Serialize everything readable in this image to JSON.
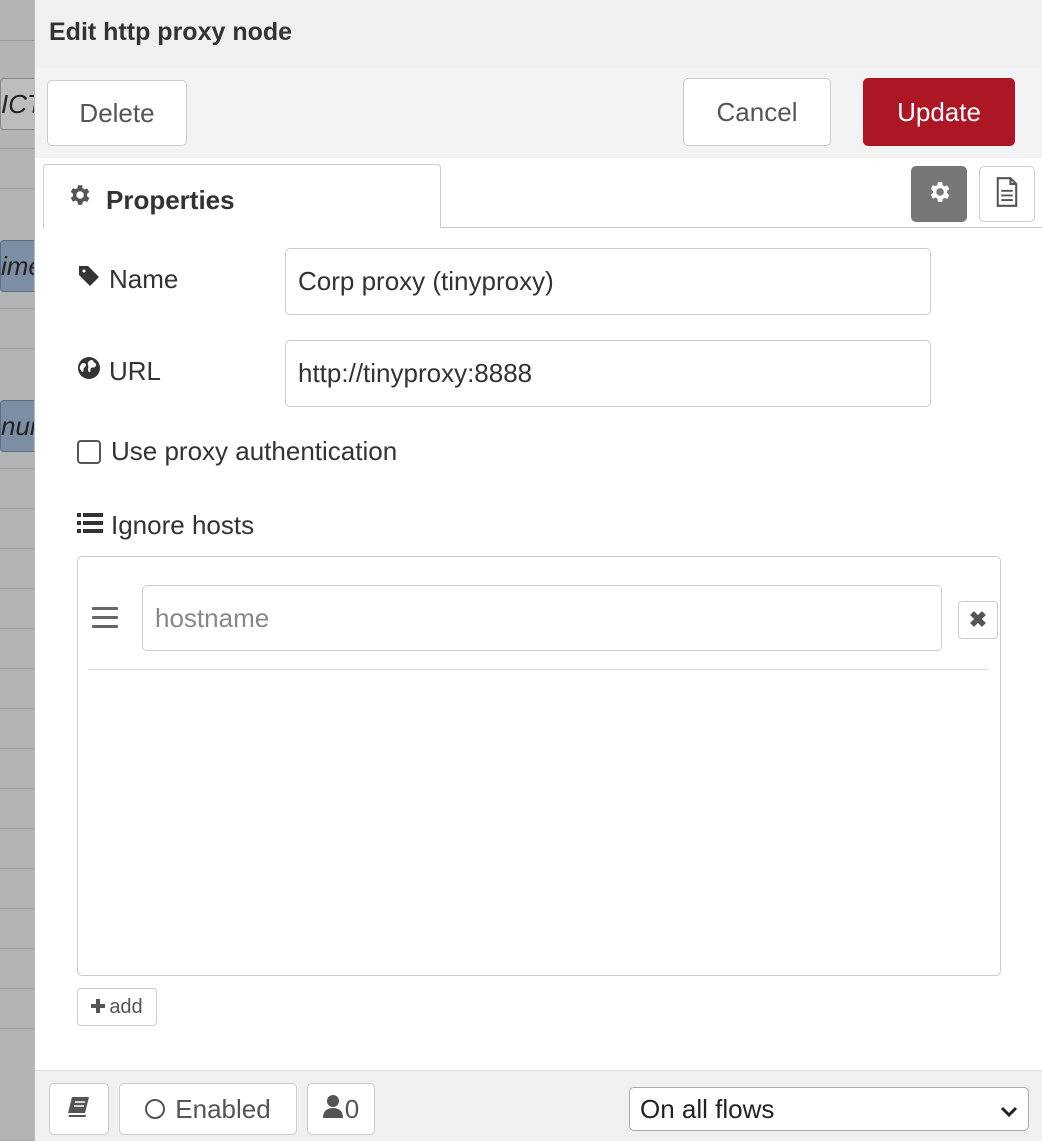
{
  "dialog": {
    "title": "Edit http proxy node",
    "delete_label": "Delete",
    "cancel_label": "Cancel",
    "update_label": "Update",
    "accent_color": "#ad1625"
  },
  "tabs": {
    "properties_label": "Properties"
  },
  "form": {
    "name_label": "Name",
    "name_value": "Corp proxy (tinyproxy)",
    "url_label": "URL",
    "url_value": "http://tinyproxy:8888",
    "auth_label": "Use proxy authentication",
    "auth_checked": false,
    "ignore_hosts_label": "Ignore hosts",
    "hostname_placeholder": "hostname",
    "add_label": "add"
  },
  "footer": {
    "enabled_label": "Enabled",
    "users_count": "0",
    "scope_value": "On all flows"
  },
  "background": {
    "node_fragments": [
      "ICT",
      "ime",
      "nur"
    ]
  },
  "icons": [
    "gear-icon",
    "document-icon",
    "tag-icon",
    "globe-icon",
    "list-icon",
    "drag-handle-icon",
    "close-icon",
    "plus-icon",
    "book-icon",
    "user-icon",
    "chevron-down-icon"
  ]
}
